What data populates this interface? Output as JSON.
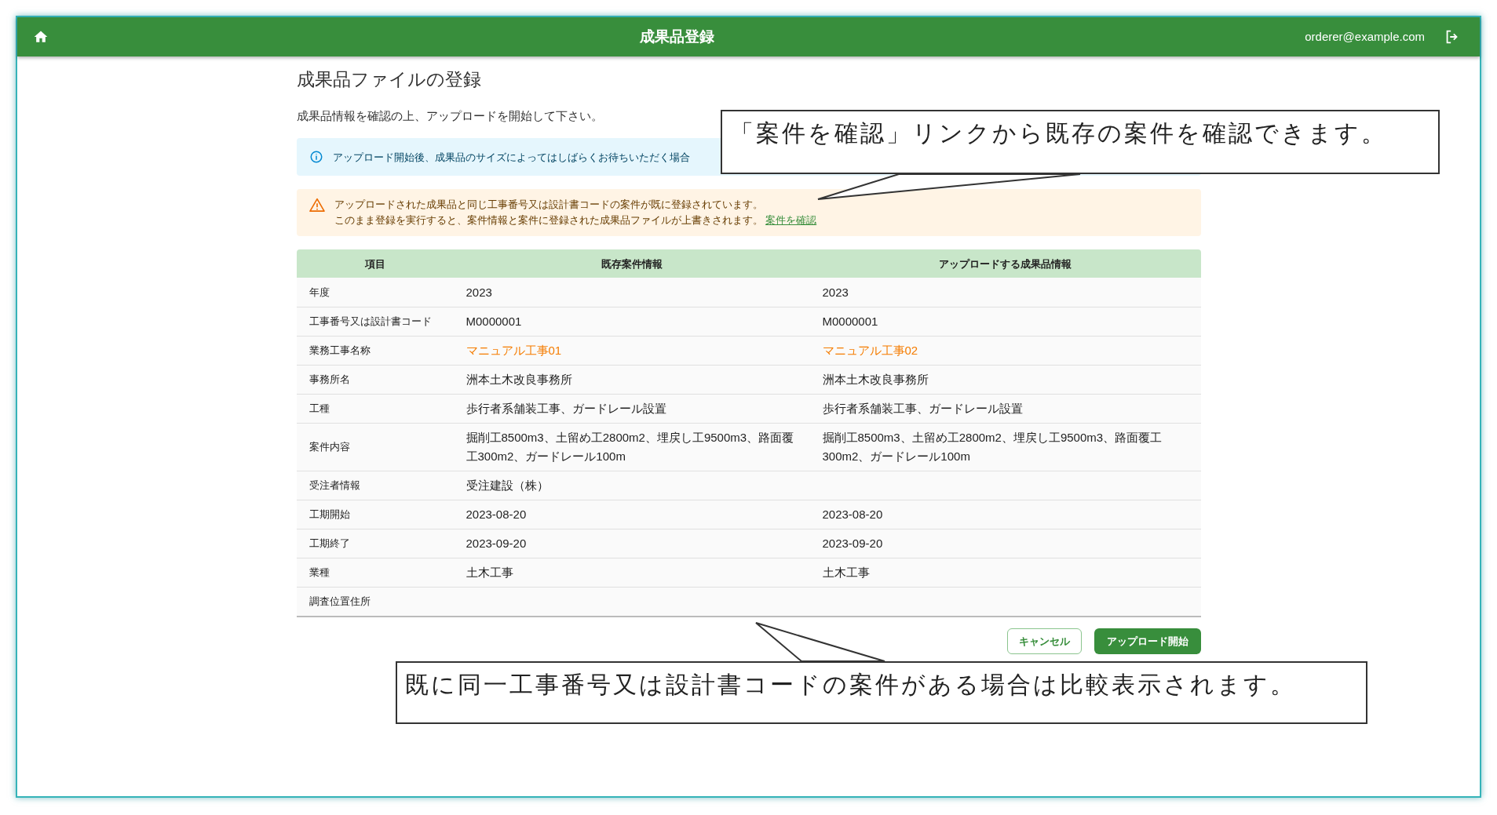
{
  "header": {
    "title": "成果品登録",
    "user": "orderer@example.com"
  },
  "page": {
    "title": "成果品ファイルの登録",
    "instruction": "成果品情報を確認の上、アップロードを開始して下さい。"
  },
  "alerts": [
    {
      "kind": "info",
      "lines": [
        "アップロード開始後、成果品のサイズによってはしばらくお待ちいただく場合"
      ]
    },
    {
      "kind": "warning",
      "lines": [
        "アップロードされた成果品と同じ工事番号又は設計書コードの案件が既に登録されています。",
        "このまま登録を実行すると、案件情報と案件に登録された成果品ファイルが上書きされます。"
      ],
      "link": "案件を確認"
    }
  ],
  "table": {
    "columns": [
      "項目",
      "既存案件情報",
      "アップロードする成果品情報"
    ],
    "rows": [
      {
        "label": "年度",
        "existing": "2023",
        "upload": "2023",
        "differs": false
      },
      {
        "label": "工事番号又は設計書コード",
        "existing": "M0000001",
        "upload": "M0000001",
        "differs": false
      },
      {
        "label": "業務工事名称",
        "existing": "マニュアル工事01",
        "upload": "マニュアル工事02",
        "differs": true
      },
      {
        "label": "事務所名",
        "existing": "洲本土木改良事務所",
        "upload": "洲本土木改良事務所",
        "differs": false
      },
      {
        "label": "工種",
        "existing": "歩行者系舗装工事、ガードレール設置",
        "upload": "歩行者系舗装工事、ガードレール設置",
        "differs": false
      },
      {
        "label": "案件内容",
        "existing": "掘削工8500m3、土留め工2800m2、埋戻し工9500m3、路面覆工300m2、ガードレール100m",
        "upload": "掘削工8500m3、土留め工2800m2、埋戻し工9500m3、路面覆工300m2、ガードレール100m",
        "differs": false
      },
      {
        "label": "受注者情報",
        "existing": "受注建設（株）",
        "differs": false
      },
      {
        "label": "工期開始",
        "existing": "2023-08-20",
        "upload": "2023-08-20",
        "differs": false
      },
      {
        "label": "工期終了",
        "existing": "2023-09-20",
        "upload": "2023-09-20",
        "differs": false
      },
      {
        "label": "業種",
        "existing": "土木工事",
        "upload": "土木工事",
        "differs": false
      },
      {
        "label": "調査位置住所"
      }
    ]
  },
  "buttons": [
    {
      "kind": "secondary",
      "label": "キャンセル"
    },
    {
      "kind": "primary",
      "label": "アップロード開始"
    }
  ],
  "callouts": [
    {
      "text": "「案件を確認」リンクから既存の案件を確認できます。"
    },
    {
      "text": "既に同一工事番号又は設計書コードの案件がある場合は比較表示されます。"
    }
  ]
}
